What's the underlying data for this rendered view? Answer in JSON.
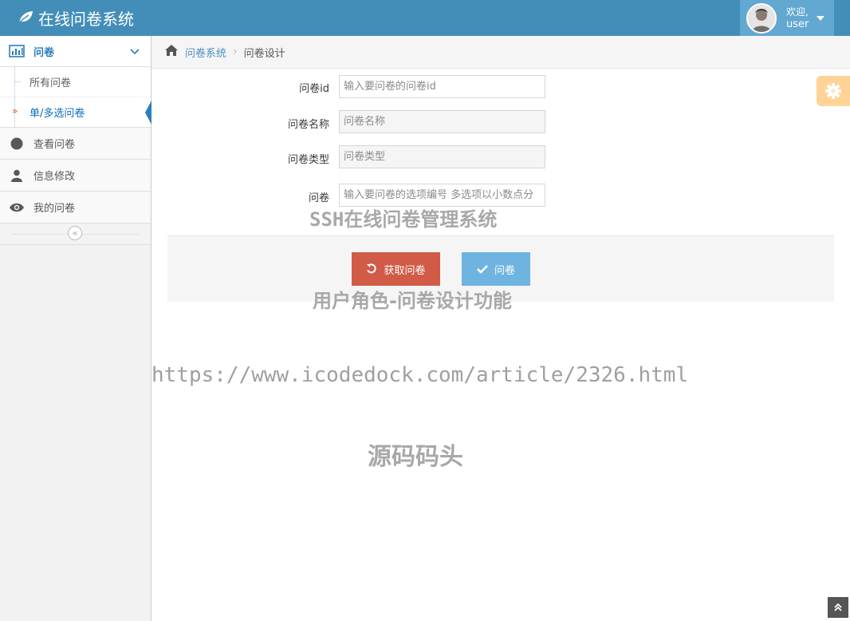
{
  "app": {
    "title": "在线问卷系统",
    "user": {
      "welcome": "欢迎,",
      "name": "user"
    }
  },
  "sidebar": {
    "menu_title": "问卷",
    "sub_items": [
      {
        "label": "所有问卷"
      },
      {
        "label": "单/多选问卷"
      }
    ],
    "items": [
      {
        "label": "查看问卷",
        "icon": "circle-icon"
      },
      {
        "label": "信息修改",
        "icon": "user-icon"
      },
      {
        "label": "我的问卷",
        "icon": "eye-icon"
      }
    ]
  },
  "breadcrumb": {
    "root": "问卷系统",
    "current": "问卷设计"
  },
  "form": {
    "id_label": "问卷id",
    "id_placeholder": "输入要问卷的问卷id",
    "name_label": "问卷名称",
    "name_placeholder": "问卷名称",
    "type_label": "问卷类型",
    "type_placeholder": "问卷类型",
    "answer_label": "问卷",
    "answer_placeholder": "输入要问卷的选项编号 多选项以小数点分"
  },
  "actions": {
    "fetch_label": "获取问卷",
    "submit_label": "问卷"
  },
  "watermark": {
    "line1": "SSH在线问卷管理系统",
    "line2": "用户角色-问卷设计功能",
    "line3": "https://www.icodedock.com/article/2326.html",
    "line4": "源码码头"
  },
  "colors": {
    "navbar": "#438eb9",
    "accent": "#2b7dbc",
    "danger": "#d15b47",
    "info": "#6fb3e0",
    "warning": "#ffb752"
  }
}
